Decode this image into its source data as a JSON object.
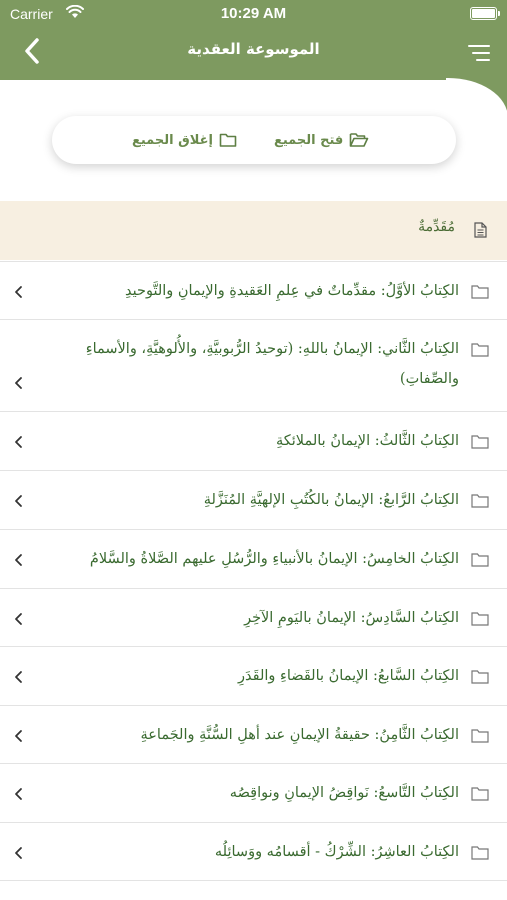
{
  "status_bar": {
    "carrier": "Carrier",
    "time": "10:29 AM"
  },
  "header": {
    "title": "الموسوعة العقدية"
  },
  "toggles": {
    "open_all": "فتح الجميع",
    "close_all": "إغلاق الجميع"
  },
  "intro": {
    "label": "مُقَدِّمةٌ"
  },
  "chapters": [
    {
      "title": "الكِتابُ الأوَّلُ: مقدِّماتٌ في عِلمِ العَقيدةِ والإيمانِ والتَّوحيدِ"
    },
    {
      "title": "الكِتابُ الثَّاني: الإيمانُ باللهِ: (توحيدُ الرُّبوبيَّةِ، والأُلوهيَّةِ، والأسماءِ والصِّفاتِ)"
    },
    {
      "title": "الكِتابُ الثَّالثُ: الإيمانُ بالملائكةِ"
    },
    {
      "title": "الكِتابُ الرَّابعُ: الإيمانُ بالكُتُبِ الإلهيَّةِ المُنَزَّلةِ"
    },
    {
      "title": "الكِتابُ الخامِسُ: الإيمانُ بالأنبياءِ والرُّسُلِ عليهم الصَّلاةُ والسَّلامُ"
    },
    {
      "title": "الكِتابُ السَّادِسُ: الإيمانُ باليَومِ الآخِرِ"
    },
    {
      "title": "الكِتابُ السَّابعُ: الإيمانُ بالقَضاءِ والقَدَرِ"
    },
    {
      "title": "الكِتابُ الثَّامِنُ: حقيقةُ الإيمانِ عند أهلِ السُّنَّةِ والجَماعةِ"
    },
    {
      "title": "الكِتابُ التَّاسعُ: نَواقِضُ الإيمانِ ونواقِصُه"
    },
    {
      "title": "الكِتابُ العاشِرُ: الشِّرْكُ - أقسامُه ووَسائِلُه"
    }
  ],
  "icons": {
    "back": "chevron-left-icon",
    "menu": "menu-icon",
    "folder": "folder-icon",
    "folder_open": "folder-open-icon",
    "document": "document-icon",
    "row_chevron": "chevron-left-icon"
  },
  "colors": {
    "primary": "#7e9a60",
    "text_green": "#3a6a30",
    "intro_bg": "#f7efe1"
  }
}
